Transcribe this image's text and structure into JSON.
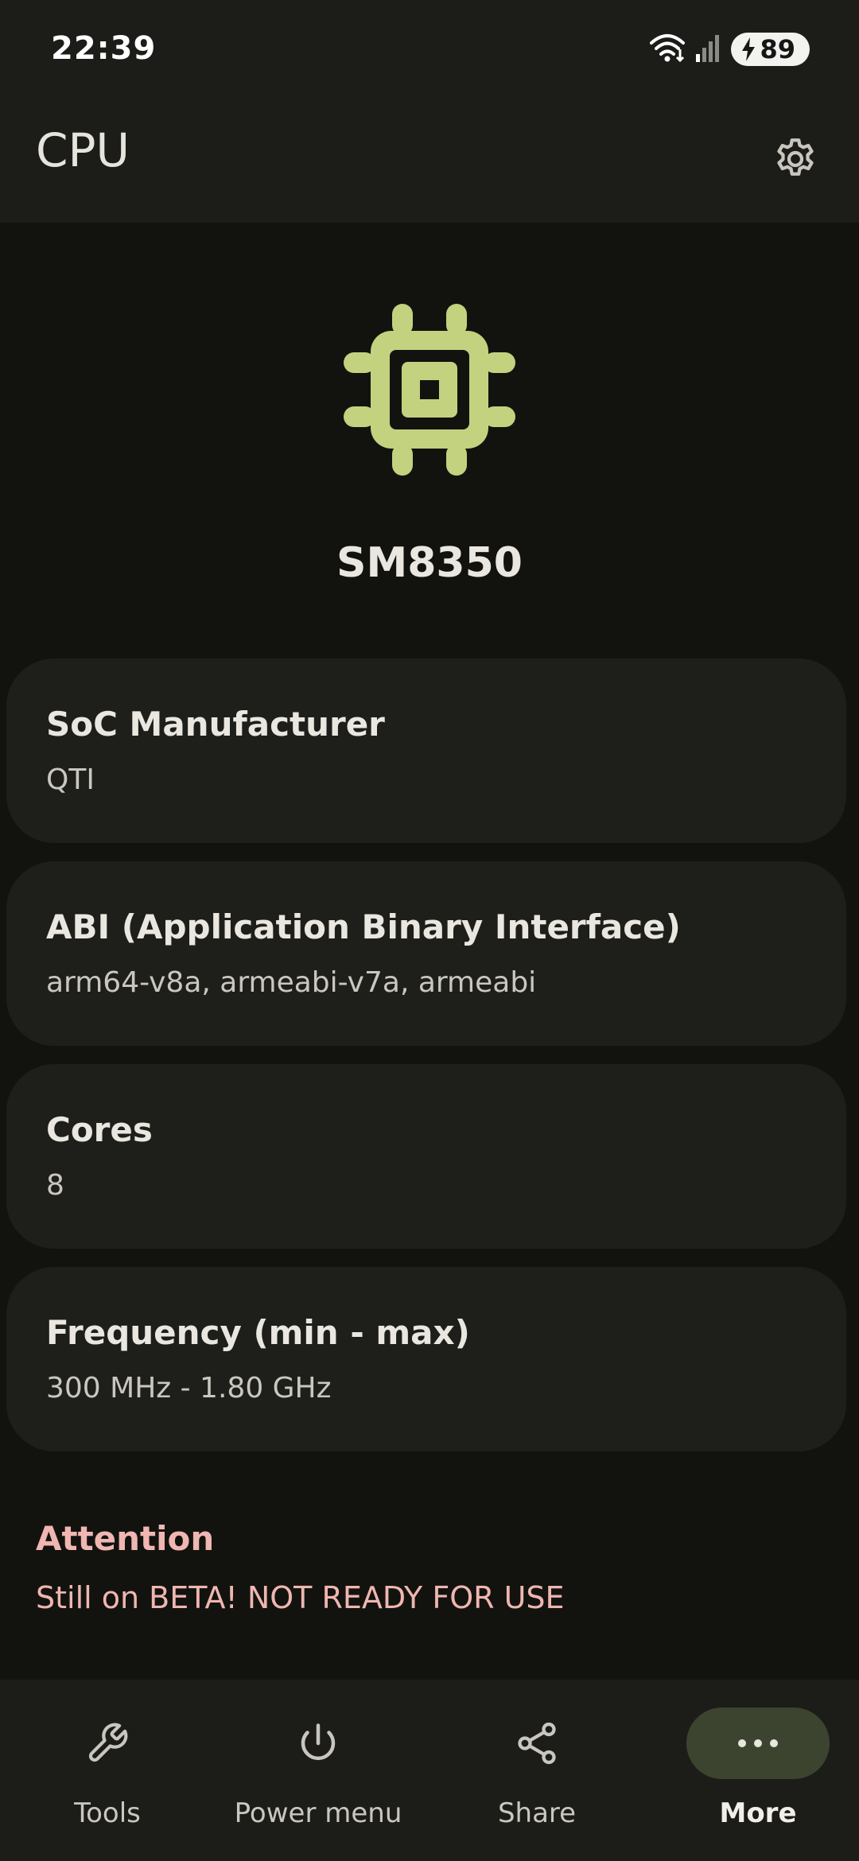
{
  "status_bar": {
    "time": "22:39",
    "battery": "89"
  },
  "app_bar": {
    "title": "CPU"
  },
  "hero": {
    "icon": "cpu-chip-icon",
    "soc_name": "SM8350"
  },
  "cards": [
    {
      "title": "SoC Manufacturer",
      "value": "QTI"
    },
    {
      "title": "ABI (Application Binary Interface)",
      "value": "arm64-v8a, armeabi-v7a, armeabi"
    },
    {
      "title": "Cores",
      "value": "8"
    },
    {
      "title": "Frequency (min - max)",
      "value": "300 MHz - 1.80 GHz"
    }
  ],
  "attention": {
    "title": "Attention",
    "text": "Still on BETA! NOT READY FOR USE"
  },
  "bottom_nav": {
    "items": [
      {
        "label": "Tools",
        "icon": "wrench-icon"
      },
      {
        "label": "Power menu",
        "icon": "power-icon"
      },
      {
        "label": "Share",
        "icon": "share-icon"
      },
      {
        "label": "More",
        "icon": "more-horizontal-icon",
        "active": true
      }
    ]
  },
  "colors": {
    "accent": "#c2d27e",
    "background": "#12130f",
    "surface": "#1e1f1b",
    "warning": "#f0b6b1",
    "nav_active": "#3c4430"
  }
}
